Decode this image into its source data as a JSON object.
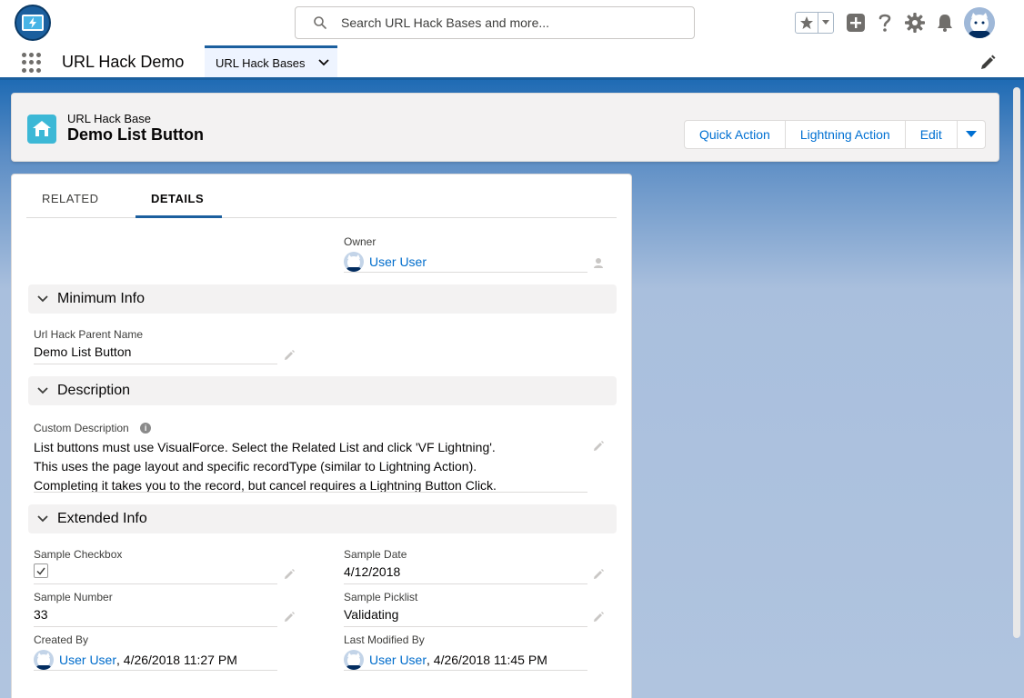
{
  "header": {
    "search_placeholder": "Search URL Hack Bases and more..."
  },
  "nav": {
    "app_name": "URL Hack Demo",
    "active_tab": "URL Hack Bases"
  },
  "record": {
    "object_type": "URL Hack Base",
    "title": "Demo List Button",
    "actions": [
      "Quick Action",
      "Lightning Action",
      "Edit"
    ]
  },
  "tabs": {
    "related": "Related",
    "details": "Details"
  },
  "fields": {
    "owner_label": "Owner",
    "owner_value": "User User",
    "section_minimum": "Minimum Info",
    "parent_name_label": "Url Hack Parent Name",
    "parent_name_value": "Demo List Button",
    "section_description": "Description",
    "custom_description_label": "Custom Description",
    "custom_description_lines": [
      "List buttons must use VisualForce. Select the Related List and click 'VF Lightning'.",
      "This uses the page layout and specific recordType (similar to Lightning Action).",
      "Completing it takes you to the record, but cancel requires a Lightning Button Click."
    ],
    "section_extended": "Extended Info",
    "sample_checkbox_label": "Sample Checkbox",
    "sample_date_label": "Sample Date",
    "sample_date_value": "4/12/2018",
    "sample_number_label": "Sample Number",
    "sample_number_value": "33",
    "sample_picklist_label": "Sample Picklist",
    "sample_picklist_value": "Validating",
    "created_by_label": "Created By",
    "created_by_user": "User User",
    "created_by_date": ", 4/26/2018 11:27 PM",
    "modified_by_label": "Last Modified By",
    "modified_by_user": "User User",
    "modified_by_date": ", 4/26/2018 11:45 PM"
  },
  "colors": {
    "brand": "#1b5f9e",
    "link": "#006dcc",
    "object_icon": "#3cb8d6"
  }
}
